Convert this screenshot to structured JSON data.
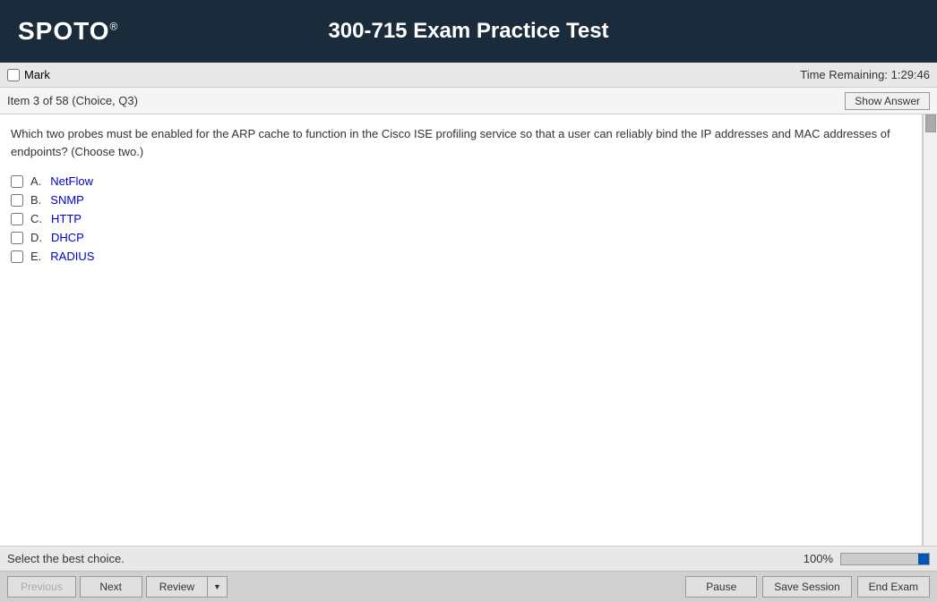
{
  "header": {
    "logo": "SPOTO",
    "logo_superscript": "®",
    "title": "300-715 Exam Practice Test"
  },
  "mark_bar": {
    "mark_label": "Mark",
    "time_remaining_label": "Time Remaining: 1:29:46"
  },
  "item_bar": {
    "item_info": "Item 3 of 58  (Choice, Q3)",
    "show_answer_label": "Show Answer"
  },
  "question": {
    "text": "Which two probes must be enabled for the ARP cache to function in the Cisco ISE profiling service so that a user can reliably bind the IP addresses and MAC addresses of endpoints? (Choose two.)",
    "options": [
      {
        "letter": "A.",
        "text": "NetFlow"
      },
      {
        "letter": "B.",
        "text": "SNMP"
      },
      {
        "letter": "C.",
        "text": "HTTP"
      },
      {
        "letter": "D.",
        "text": "DHCP"
      },
      {
        "letter": "E.",
        "text": "RADIUS"
      }
    ]
  },
  "status_bar": {
    "text": "Select the best choice.",
    "progress_percent": "100%"
  },
  "footer": {
    "previous_label": "Previous",
    "next_label": "Next",
    "review_label": "Review",
    "pause_label": "Pause",
    "save_session_label": "Save Session",
    "end_exam_label": "End Exam"
  }
}
